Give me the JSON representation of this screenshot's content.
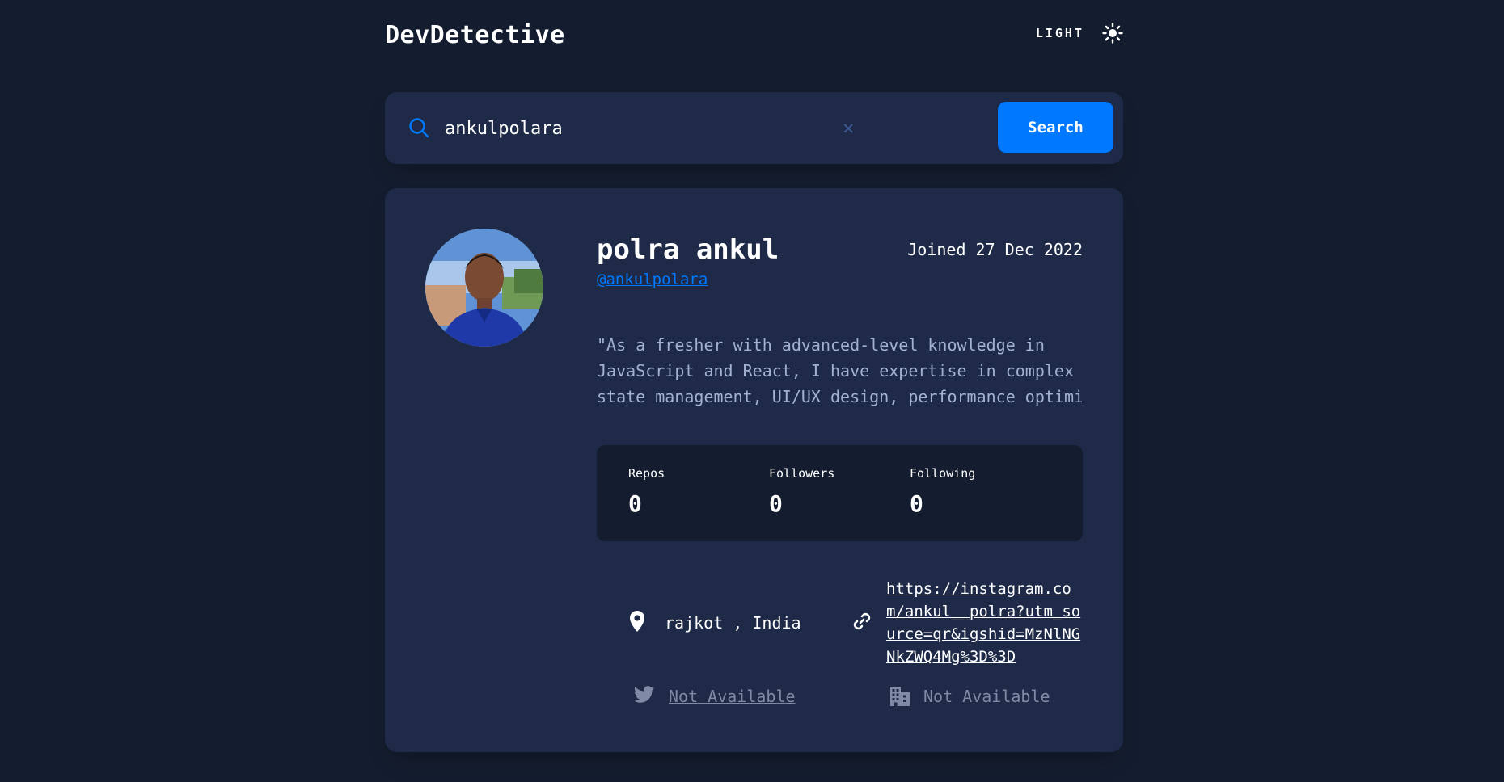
{
  "header": {
    "brand": "DevDetective",
    "theme_label": "LIGHT"
  },
  "search": {
    "value": "ankulpolara",
    "button_label": "Search",
    "clear_glyph": "✕"
  },
  "profile": {
    "name": "polra ankul",
    "joined": "Joined 27 Dec 2022",
    "handle": "@ankulpolara",
    "bio_lines": [
      "\"As a fresher with advanced-level knowledge in",
      "JavaScript and React, I have expertise in complex",
      "state management, UI/UX design, performance optimiza"
    ]
  },
  "stats": [
    {
      "label": "Repos",
      "value": "0"
    },
    {
      "label": "Followers",
      "value": "0"
    },
    {
      "label": "Following",
      "value": "0"
    }
  ],
  "links": {
    "location": "rajkot , India",
    "website": "https://instagram.com/ankul__polra?utm_source=qr&igshid=MzNlNGNkZWQ4Mg%3D%3D",
    "twitter": "Not Available",
    "company": "Not Available"
  },
  "colors": {
    "background": "#141d2f",
    "card": "#1e2a47",
    "accent": "#0079ff",
    "muted": "#7e8aa6"
  },
  "icons": [
    "sun-icon",
    "search-icon",
    "close-icon",
    "location-icon",
    "link-icon",
    "twitter-icon",
    "company-icon"
  ]
}
